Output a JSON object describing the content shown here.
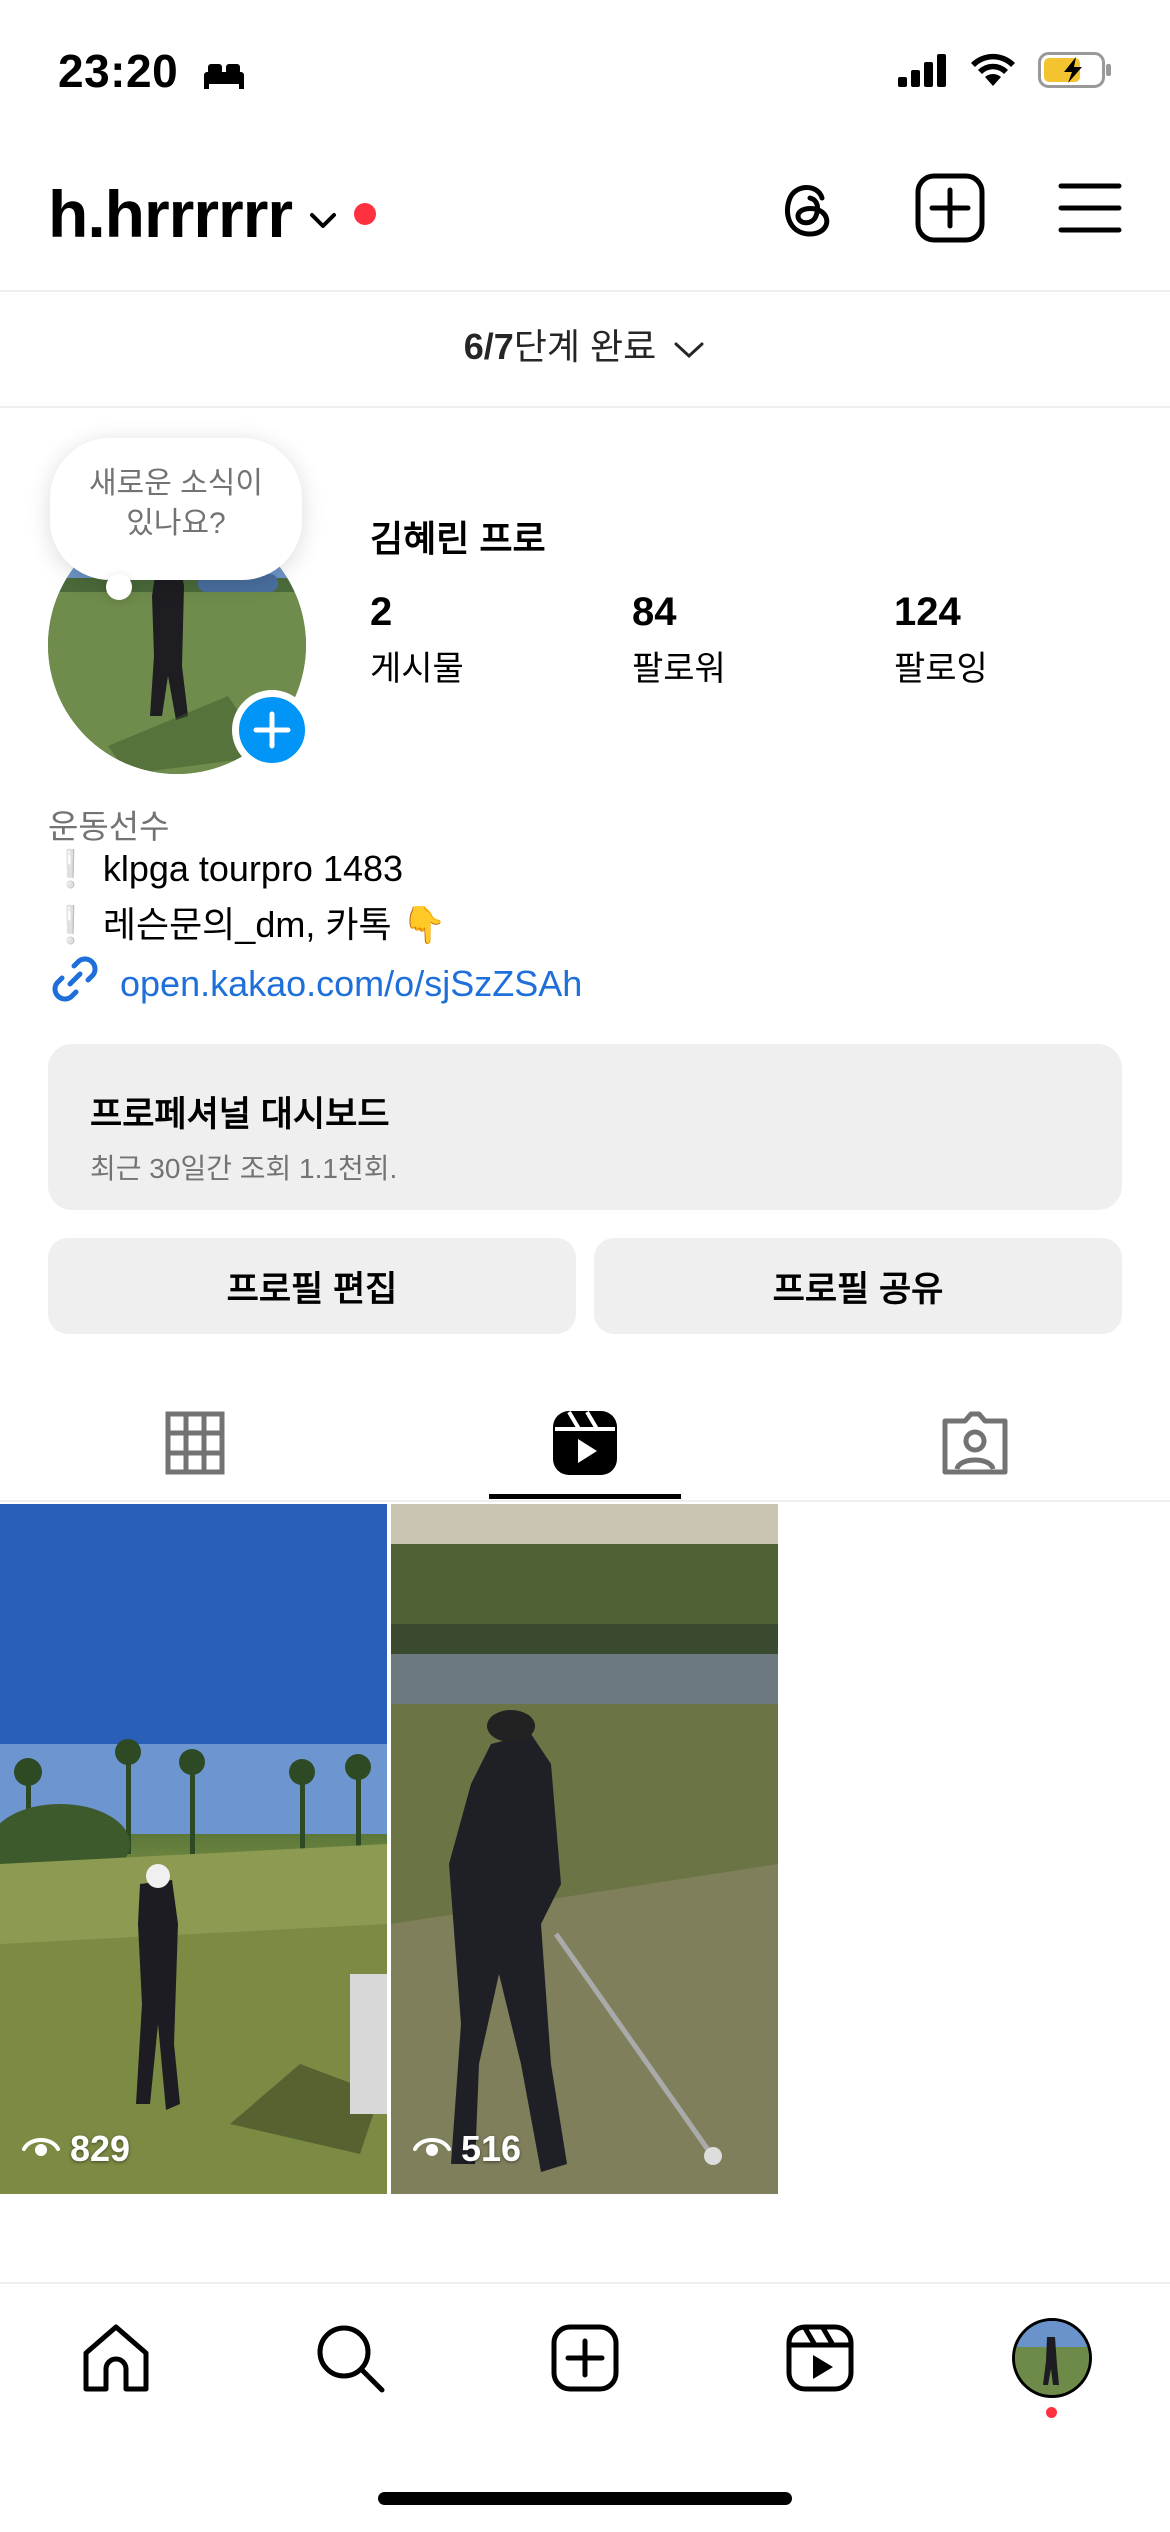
{
  "status_bar": {
    "time": "23:20",
    "icons": [
      "bed-icon",
      "cellular-signal-icon",
      "wifi-icon",
      "battery-charging-icon"
    ]
  },
  "header": {
    "username": "h.hrrrrrr",
    "icons": [
      "chevron-down-icon",
      "threads-icon",
      "new-post-icon",
      "menu-icon"
    ]
  },
  "setup": {
    "progress": "6/7",
    "label": "단계 완료"
  },
  "profile": {
    "story_prompt_line1": "새로운 소식이",
    "story_prompt_line2": "있나요?",
    "full_name": "김혜린 프로",
    "stats": [
      {
        "value": "2",
        "label": "게시물"
      },
      {
        "value": "84",
        "label": "팔로워"
      },
      {
        "value": "124",
        "label": "팔로잉"
      }
    ],
    "category": "운동선수",
    "bio_lines": [
      "❕ klpga tourpro 1483",
      "❕ 레슨문의_dm, 카톡 👇"
    ],
    "link": "open.kakao.com/o/sjSzZSAh"
  },
  "dashboard": {
    "title": "프로페셔널 대시보드",
    "subtitle": "최근 30일간 조회 1.1천회."
  },
  "buttons": {
    "edit": "프로필 편집",
    "share": "프로필 공유"
  },
  "tabs": {
    "items": [
      "grid-icon",
      "reels-icon",
      "tagged-icon"
    ],
    "active": "reels"
  },
  "reels": [
    {
      "views": "829"
    },
    {
      "views": "516"
    }
  ],
  "bottom_nav": {
    "items": [
      "home-icon",
      "search-icon",
      "create-icon",
      "reels-icon",
      "profile-avatar"
    ]
  },
  "colors": {
    "accent_blue": "#0095f6",
    "link_blue": "#1e6fd9",
    "notification_red": "#ff3040",
    "secondary_text": "#737373",
    "surface_gray": "#efefef"
  }
}
